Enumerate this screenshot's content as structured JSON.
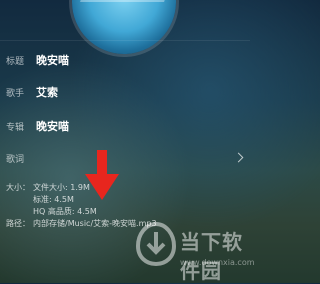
{
  "fields": {
    "title": {
      "label": "标题",
      "value": "晚安喵"
    },
    "artist": {
      "label": "歌手",
      "value": "艾索"
    },
    "album": {
      "label": "专辑",
      "value": "晚安喵"
    },
    "lyrics": {
      "label": "歌词"
    }
  },
  "size": {
    "label": "大小：",
    "file_size": "文件大小: 1.9M",
    "standard": "标准: 4.5M",
    "hq": "HQ 高品质: 4.5M"
  },
  "path": {
    "label": "路径：",
    "value": "内部存储/Music/艾索-晚安喵.mp3"
  },
  "watermark": {
    "name": "当下软件园",
    "url": "www.downxia.com"
  },
  "colors": {
    "arrow": "#e8261e"
  }
}
